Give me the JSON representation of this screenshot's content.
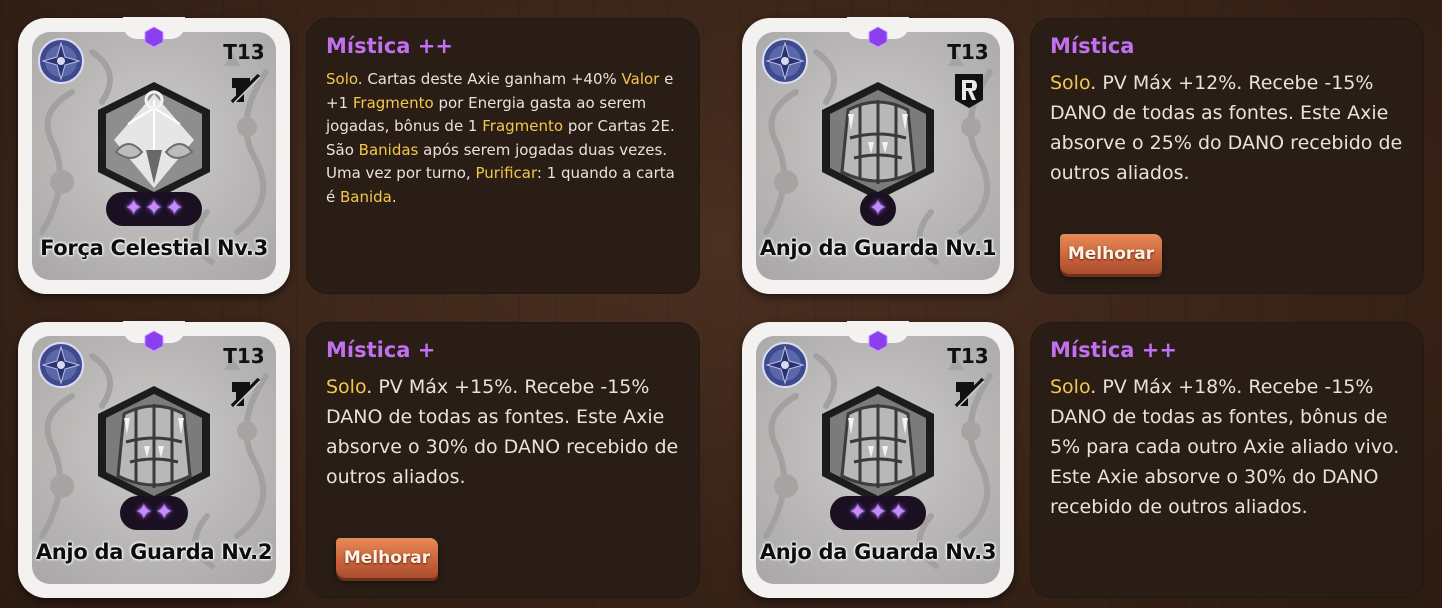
{
  "cards": [
    {
      "name": "Força Celestial Nv.3",
      "tier": "T13",
      "tag_icon": "no-attack-icon",
      "class_icon": "mystic-compass-icon",
      "art": "celestial-shell-art",
      "level_stars": 3,
      "star_glyphs": [
        "✦",
        "✦",
        "✦"
      ],
      "title": "Mística ++",
      "text_size": "small",
      "description": [
        {
          "t": "Solo",
          "k": true
        },
        {
          "t": ". Cartas deste Axie ganham +40% ",
          "k": false
        },
        {
          "t": "Valor",
          "k": true
        },
        {
          "t": " e +1 ",
          "k": false
        },
        {
          "t": "Fragmento",
          "k": true
        },
        {
          "t": " por Energia gasta ao serem jogadas, bônus de 1 ",
          "k": false
        },
        {
          "t": "Fragmento",
          "k": true
        },
        {
          "t": " por Cartas 2E. São ",
          "k": false
        },
        {
          "t": "Banidas",
          "k": true
        },
        {
          "t": " após serem jogadas duas vezes. Uma vez por turno, ",
          "k": false
        },
        {
          "t": "Purificar",
          "k": true
        },
        {
          "t": ": 1 quando a carta é ",
          "k": false
        },
        {
          "t": "Banida",
          "k": true
        },
        {
          "t": ".",
          "k": false
        }
      ],
      "upgrade_label": ""
    },
    {
      "name": "Anjo da Guarda Nv.1",
      "tier": "T13",
      "tag_icon": "r-shield-icon",
      "class_icon": "mystic-compass-icon",
      "art": "guardian-armor-art",
      "level_stars": 1,
      "star_glyphs": [
        "✦"
      ],
      "title": "Mística",
      "text_size": "large",
      "description": [
        {
          "t": "Solo",
          "k": true
        },
        {
          "t": ". PV Máx +12%. Recebe -15% DANO de todas as fontes. Este Axie absorve o 25% do DANO recebido de outros aliados.",
          "k": false
        }
      ],
      "upgrade_label": "Melhorar"
    },
    {
      "name": "Anjo da Guarda Nv.2",
      "tier": "T13",
      "tag_icon": "no-attack-icon",
      "class_icon": "mystic-compass-icon",
      "art": "guardian-armor-art",
      "level_stars": 2,
      "star_glyphs": [
        "✦",
        "✦"
      ],
      "title": "Mística +",
      "text_size": "large",
      "description": [
        {
          "t": "Solo",
          "k": true
        },
        {
          "t": ". PV Máx +15%. Recebe -15% DANO de todas as fontes. Este Axie absorve o 30% do DANO recebido de outros aliados.",
          "k": false
        }
      ],
      "upgrade_label": "Melhorar"
    },
    {
      "name": "Anjo da Guarda Nv.3",
      "tier": "T13",
      "tag_icon": "no-attack-icon",
      "class_icon": "mystic-compass-icon",
      "art": "guardian-armor-art",
      "level_stars": 3,
      "star_glyphs": [
        "✦",
        "✦",
        "✦"
      ],
      "title": "Mística ++",
      "text_size": "large",
      "description": [
        {
          "t": "Solo",
          "k": true
        },
        {
          "t": ". PV Máx +18%. Recebe -15% DANO de todas as fontes, bônus de 5% para cada outro Axie aliado vivo. Este Axie absorve o 30% do DANO recebido de outros aliados.",
          "k": false
        }
      ],
      "upgrade_label": ""
    }
  ],
  "colors": {
    "title_mystic": "#c070f0",
    "keyword": "#f2c84b",
    "panel": "#2a1d15",
    "upgrade_button": "#d06a3e"
  }
}
